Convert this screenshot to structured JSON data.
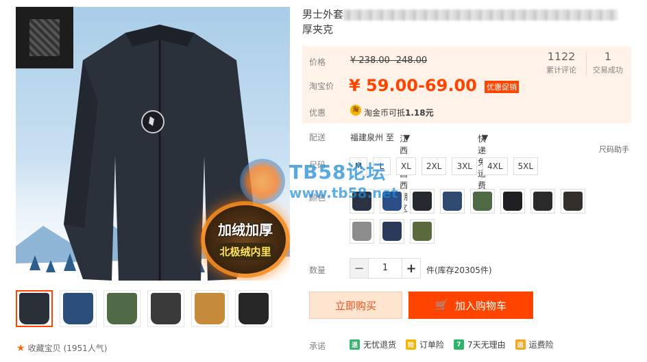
{
  "product": {
    "title_start": "男士外套",
    "title_end": "厚夹克",
    "main_image_badge": {
      "line1": "加绒加厚",
      "line2": "北极绒内里"
    }
  },
  "gallery": {
    "thumbnail_colors": [
      "#2b2f38",
      "#2c4e7a",
      "#4f6a44",
      "#3a3a3a",
      "#c58a3a",
      "#262626"
    ],
    "favorite_label": "收藏宝贝",
    "favorite_count": "(1951人气)"
  },
  "price": {
    "label": "价格",
    "original": "¥ 238.00 -248.00",
    "taobao_label": "淘宝价",
    "current": "¥ 59.00-69.00",
    "promo_tag": "优惠促销",
    "accent_color": "#ff4400"
  },
  "stats": [
    {
      "value": "1122",
      "label": "累计评论"
    },
    {
      "value": "1",
      "label": "交易成功"
    }
  ],
  "discount": {
    "label": "优惠",
    "icon": "淘",
    "text": "淘金币可抵",
    "amount": "1.18元"
  },
  "shipping": {
    "label": "配送",
    "origin": "福建泉州 至",
    "destination": "江西南昌西湖区",
    "method": "快递 免运费"
  },
  "size": {
    "label": "尺码",
    "helper": "尺码助手",
    "options": [
      "M",
      "L",
      "XL",
      "2XL",
      "3XL",
      "4XL",
      "5XL"
    ]
  },
  "watermark": {
    "title": "TB58论坛",
    "url": "www.tb58.net"
  },
  "color": {
    "label": "颜色",
    "swatches": [
      "#2a3244",
      "#2c4e86",
      "#262a30",
      "#2f4a6e",
      "#4d6a44",
      "#1f1f22",
      "#2b2b2b",
      "#33302c",
      "#8c8c8c",
      "#2a3a5a",
      "#5a6a3c"
    ]
  },
  "quantity": {
    "label": "数量",
    "minus": "−",
    "value": "1",
    "plus": "+",
    "stock": "件(库存20305件)"
  },
  "actions": {
    "buy_now": "立即购买",
    "add_to_cart": "加入购物车"
  },
  "promise": {
    "label": "承诺",
    "items": [
      {
        "icon": "退",
        "color": "#3cb371",
        "text": "无忧退货"
      },
      {
        "icon": "险",
        "color": "#f5b400",
        "text": "订单险"
      },
      {
        "icon": "7",
        "color": "#2fb56a",
        "text": "7天无理由"
      },
      {
        "icon": "运",
        "color": "#f5a623",
        "text": "运费险"
      }
    ]
  }
}
